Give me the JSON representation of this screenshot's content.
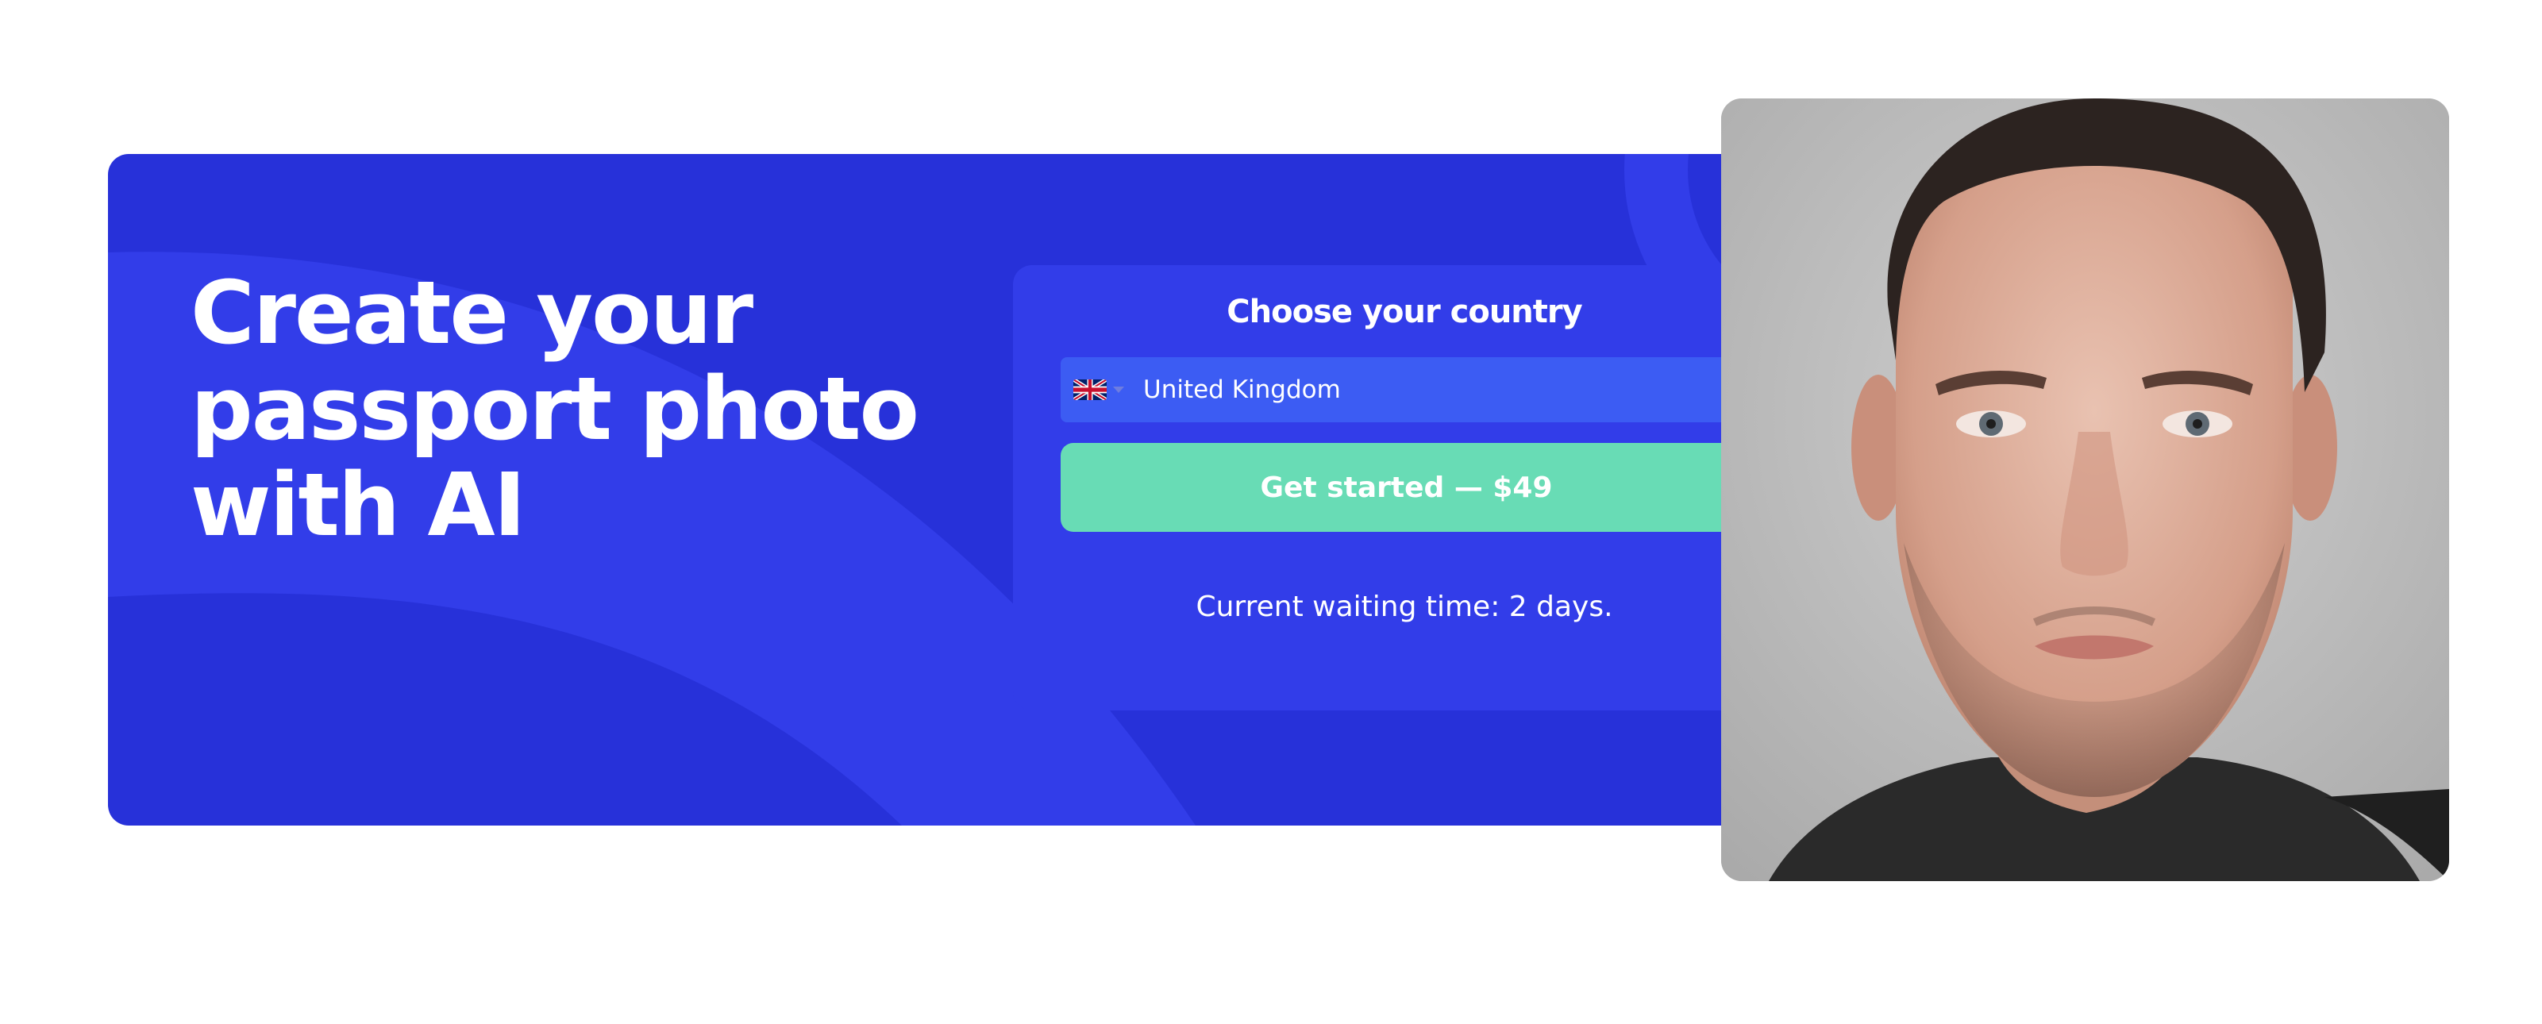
{
  "hero": {
    "headline_line1": "Create your",
    "headline_line2": "passport photo",
    "headline_line3": "with AI"
  },
  "country_panel": {
    "title": "Choose your country",
    "selected_country": "United Kingdom",
    "flag_icon": "uk-flag-icon",
    "cta_label": "Get started — $49",
    "waiting_time": "Current waiting time: 2 days."
  },
  "colors": {
    "hero_bg": "#2731d9",
    "hero_deco": "#323de9",
    "panel_bg": "#323de9",
    "select_bg": "#3c5cf3",
    "cta_bg": "#68dcb5",
    "text": "#ffffff"
  }
}
